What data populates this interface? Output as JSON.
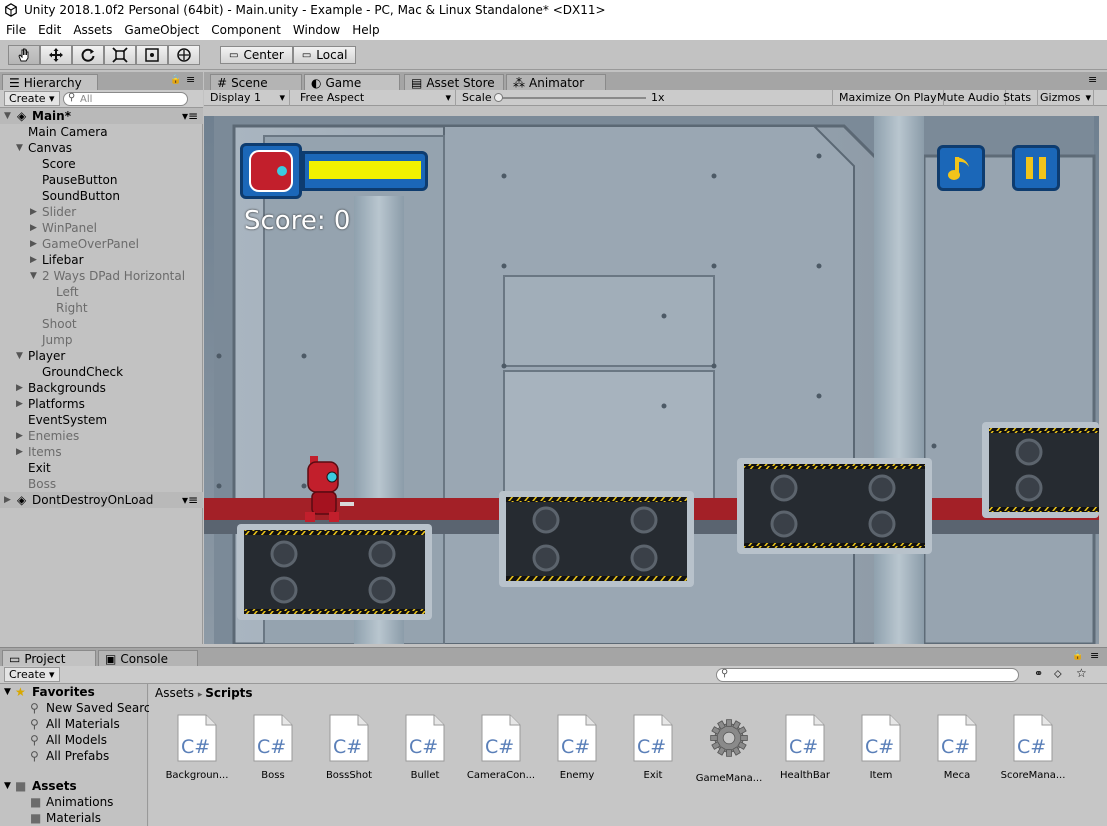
{
  "window": {
    "title": "Unity 2018.1.0f2 Personal (64bit) - Main.unity - Example - PC, Mac & Linux Standalone* <DX11>"
  },
  "menu": [
    "File",
    "Edit",
    "Assets",
    "GameObject",
    "Component",
    "Window",
    "Help"
  ],
  "toolbar": {
    "pivot_label": "Center",
    "space_label": "Local"
  },
  "hierarchy": {
    "tab": "Hierarchy",
    "create_label": "Create",
    "search_placeholder": "All",
    "scene": "Main*",
    "items": [
      "Main Camera",
      "Canvas",
      "Score",
      "PauseButton",
      "SoundButton",
      "Slider",
      "WinPanel",
      "GameOverPanel",
      "Lifebar",
      "2 Ways DPad Horizontal",
      "Left",
      "Right",
      "Shoot",
      "Jump",
      "Player",
      "GroundCheck",
      "Backgrounds",
      "Platforms",
      "EventSystem",
      "Enemies",
      "Items",
      "Exit",
      "Boss"
    ],
    "dontdestroy": "DontDestroyOnLoad"
  },
  "game": {
    "tabs": [
      "Scene",
      "Game",
      "Asset Store",
      "Animator"
    ],
    "display": "Display 1",
    "aspect": "Free Aspect",
    "scale_label": "Scale",
    "scale_value": "1x",
    "maximize": "Maximize On Play",
    "mute": "Mute Audio",
    "stats": "Stats",
    "gizmos": "Gizmos",
    "score_text": "Score: 0",
    "health_fraction": 1.0,
    "colors": {
      "health": "#f2f200",
      "hud_panel": "#1b67b8",
      "stripe": "#a32027"
    }
  },
  "project": {
    "tabs": [
      "Project",
      "Console"
    ],
    "create_label": "Create",
    "favorites_label": "Favorites",
    "favorites": [
      "New Saved Searc",
      "All Materials",
      "All Models",
      "All Prefabs"
    ],
    "assets_label": "Assets",
    "asset_folders": [
      "Animations",
      "Materials"
    ],
    "breadcrumb": [
      "Assets",
      "Scripts"
    ],
    "files": [
      {
        "name": "Backgroun...",
        "type": "C#"
      },
      {
        "name": "Boss",
        "type": "C#"
      },
      {
        "name": "BossShot",
        "type": "C#"
      },
      {
        "name": "Bullet",
        "type": "C#"
      },
      {
        "name": "CameraCon...",
        "type": "C#"
      },
      {
        "name": "Enemy",
        "type": "C#"
      },
      {
        "name": "Exit",
        "type": "C#"
      },
      {
        "name": "GameMana...",
        "type": "gear"
      },
      {
        "name": "HealthBar",
        "type": "C#"
      },
      {
        "name": "Item",
        "type": "C#"
      },
      {
        "name": "Meca",
        "type": "C#"
      },
      {
        "name": "ScoreMana...",
        "type": "C#"
      }
    ]
  }
}
